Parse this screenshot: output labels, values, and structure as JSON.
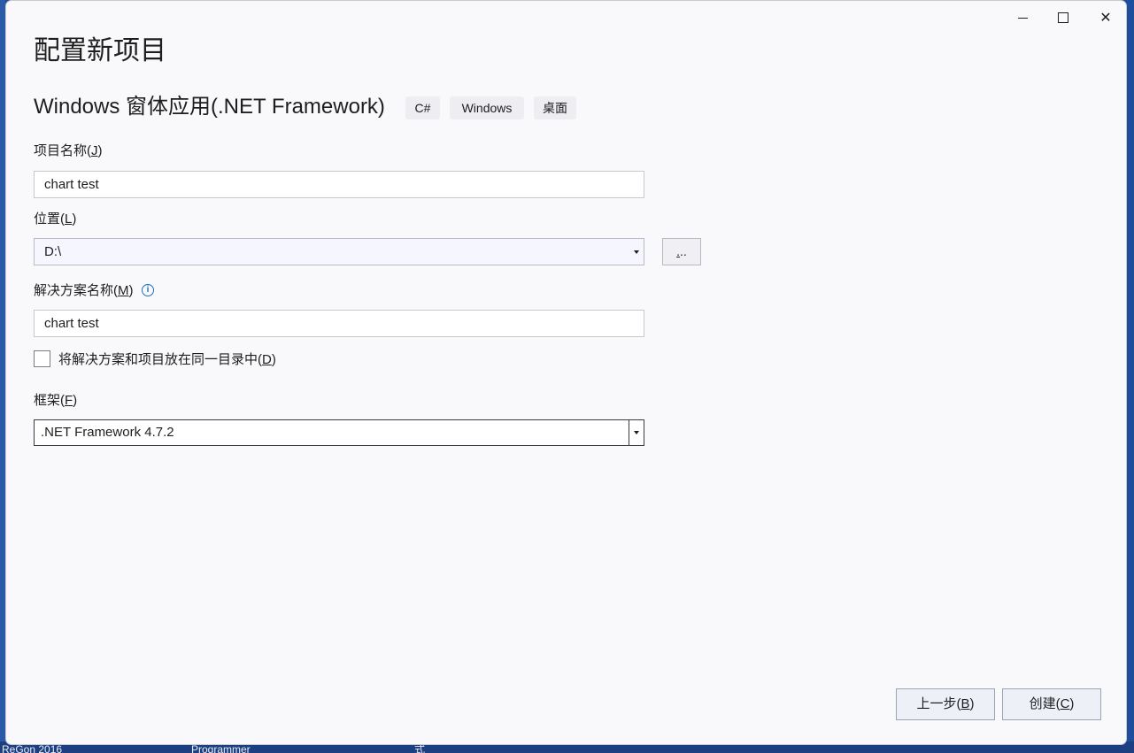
{
  "window": {
    "title": "配置新项目",
    "controls": {
      "minimize_icon": "minimize-icon",
      "maximize_icon": "maximize-icon",
      "close_icon": "close-icon",
      "close_glyph": "✕"
    }
  },
  "template": {
    "name": "Windows 窗体应用(.NET Framework)",
    "tags": [
      "C#",
      "Windows",
      "桌面"
    ]
  },
  "form": {
    "project_name": {
      "label": "项目名称(",
      "key": "J",
      "label_end": ")",
      "value": "chart test"
    },
    "location": {
      "label": "位置(",
      "key": "L",
      "label_end": ")",
      "value": "D:\\",
      "browse_label": "...",
      "browse_key": "."
    },
    "solution_name": {
      "label": "解决方案名称(",
      "key": "M",
      "label_end": ")",
      "value": "chart test",
      "info_glyph": "i"
    },
    "same_dir": {
      "label": "将解决方案和项目放在同一目录中(",
      "key": "D",
      "label_end": ")",
      "checked": false
    },
    "framework": {
      "label": "框架(",
      "key": "F",
      "label_end": ")",
      "value": ".NET Framework 4.7.2"
    }
  },
  "buttons": {
    "back": {
      "label": "上一步(",
      "key": "B",
      "label_end": ")"
    },
    "create": {
      "label": "创建(",
      "key": "C",
      "label_end": ")"
    }
  },
  "desktop_taskbar_fragments": [
    "ReGon 2016",
    "Programmer",
    "式"
  ],
  "colors": {
    "window_bg": "#f9f9fb",
    "desktop_bg": "#1f4e9c",
    "info_accent": "#1a70c0"
  }
}
